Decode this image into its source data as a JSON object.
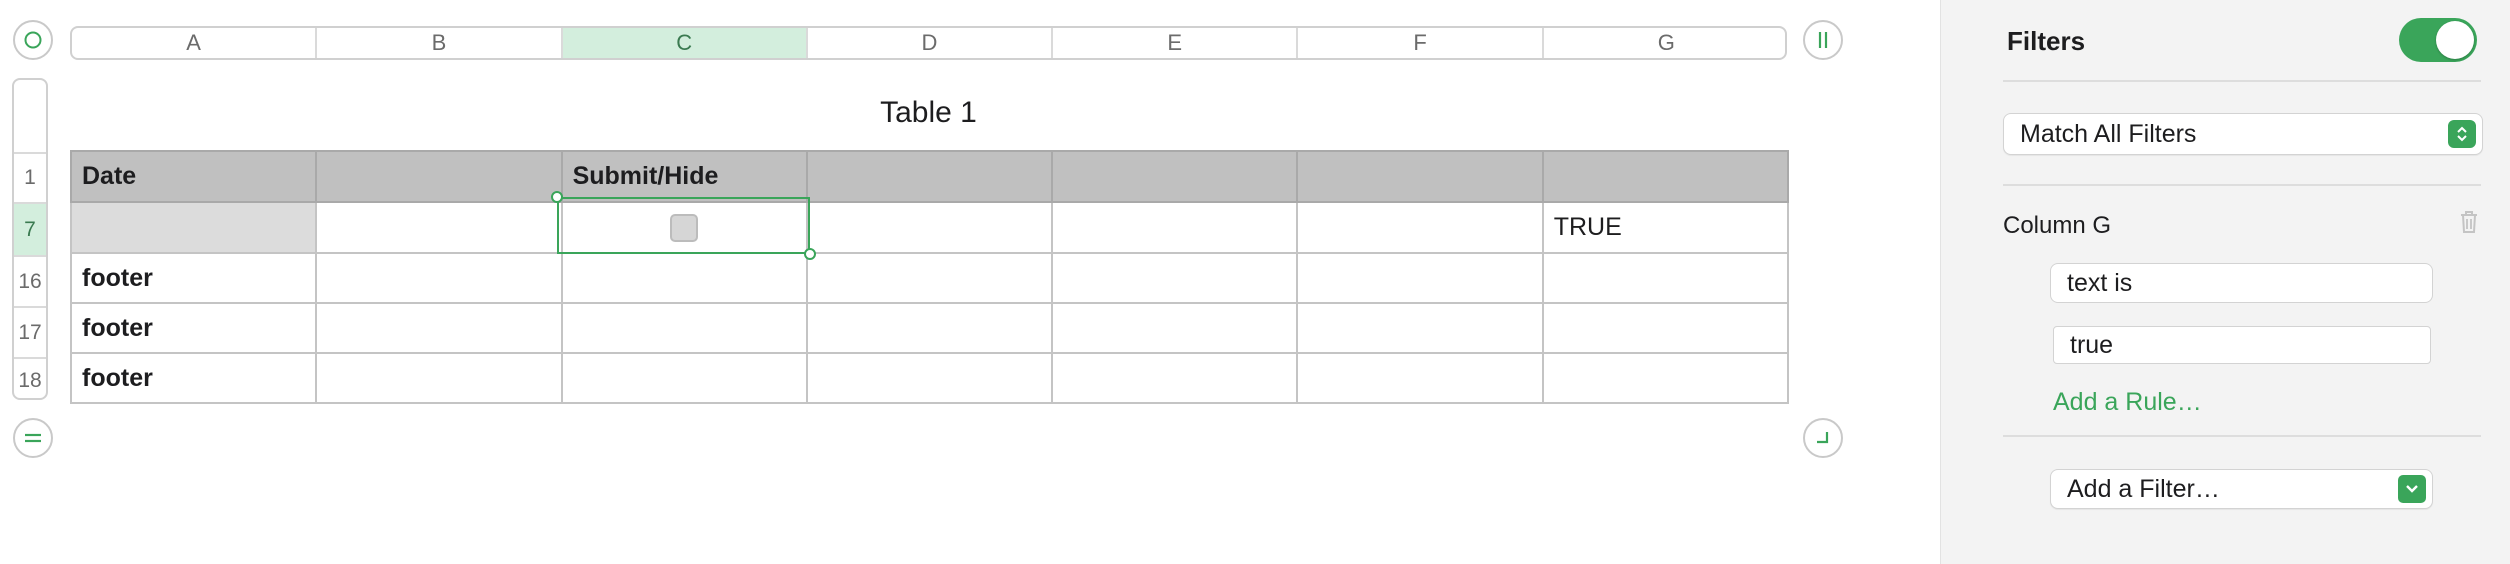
{
  "sheet": {
    "table_title": "Table 1",
    "columns": [
      "A",
      "B",
      "C",
      "D",
      "E",
      "F",
      "G"
    ],
    "selected_column": "C",
    "row_numbers": [
      "1",
      "7",
      "16",
      "17",
      "18"
    ],
    "selected_row": "7",
    "header_row": [
      "Date",
      "",
      "Submit/Hide",
      "",
      "",
      "",
      ""
    ],
    "body_row": [
      "",
      "",
      "",
      "",
      "",
      "",
      "TRUE"
    ],
    "footer_rows": [
      [
        "footer",
        "",
        "",
        "",
        "",
        "",
        ""
      ],
      [
        "footer",
        "",
        "",
        "",
        "",
        "",
        ""
      ],
      [
        "footer",
        "",
        "",
        "",
        "",
        "",
        ""
      ]
    ]
  },
  "panel": {
    "title": "Filters",
    "filters_enabled": true,
    "match_select": "Match All Filters",
    "filter_column_label": "Column G",
    "rule_operator": "text is",
    "rule_value": "true",
    "add_rule_link": "Add a Rule…",
    "add_filter_select": "Add a Filter…"
  },
  "colors": {
    "accent": "#3aa55a",
    "selection_fill": "#d3eedd",
    "header_fill": "#c0c0c0"
  },
  "icons": [
    "select-all-circle-icon",
    "freeze-columns-icon",
    "add-row-icon",
    "resize-table-icon",
    "trash-icon",
    "stepper-arrows-icon",
    "chevron-down-icon"
  ]
}
